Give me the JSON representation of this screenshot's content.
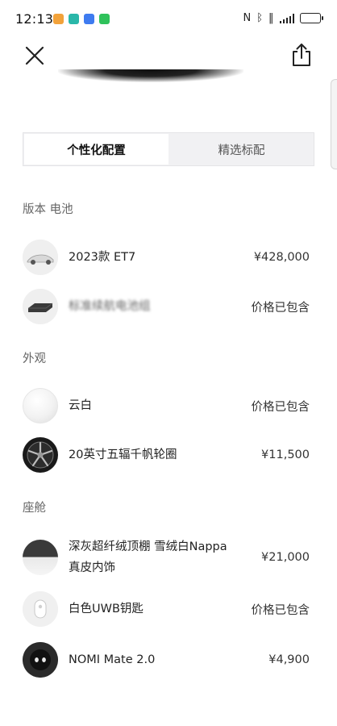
{
  "status": {
    "time": "12:13",
    "icons": [
      "app-icon-orange",
      "app-icon-teal",
      "app-icon-blue",
      "app-icon-green"
    ],
    "right_icons": [
      "nfc-icon",
      "bluetooth-icon",
      "vibrate-icon",
      "signal-icon",
      "battery-icon"
    ],
    "battery_level": 0.7,
    "colors": {
      "orange": "#f2a23a",
      "teal": "#2ab7a9",
      "blue": "#3e7bf0",
      "green": "#2fc25b"
    }
  },
  "header": {
    "close_icon": "close-icon",
    "share_icon": "share-icon"
  },
  "tabs": [
    {
      "label": "个性化配置",
      "active": true
    },
    {
      "label": "精选标配",
      "active": false
    }
  ],
  "sections": [
    {
      "title": "版本 电池",
      "items": [
        {
          "name": "2023款 ET7",
          "price": "¥428,000",
          "thumb": "car-thumbnail"
        },
        {
          "name": "标准续航电池组",
          "price": "价格已包含",
          "thumb": "battery-pack-thumbnail",
          "blurred": true
        }
      ]
    },
    {
      "title": "外观",
      "items": [
        {
          "name": "云白",
          "price": "价格已包含",
          "thumb": "white-paint-swatch"
        },
        {
          "name": "20英寸五辐千帆轮圈",
          "price": "¥11,500",
          "thumb": "wheel-thumbnail"
        }
      ]
    },
    {
      "title": "座舱",
      "items": [
        {
          "name_line1": "深灰超纤绒顶棚 雪绒白Nappa",
          "name_line2": "真皮内饰",
          "price": "¥21,000",
          "thumb": "interior-swatch"
        },
        {
          "name": "白色UWB钥匙",
          "price": "价格已包含",
          "thumb": "uwb-key-thumbnail"
        },
        {
          "name": "NOMI Mate 2.0",
          "price": "¥4,900",
          "thumb": "nomi-thumbnail"
        }
      ]
    }
  ]
}
